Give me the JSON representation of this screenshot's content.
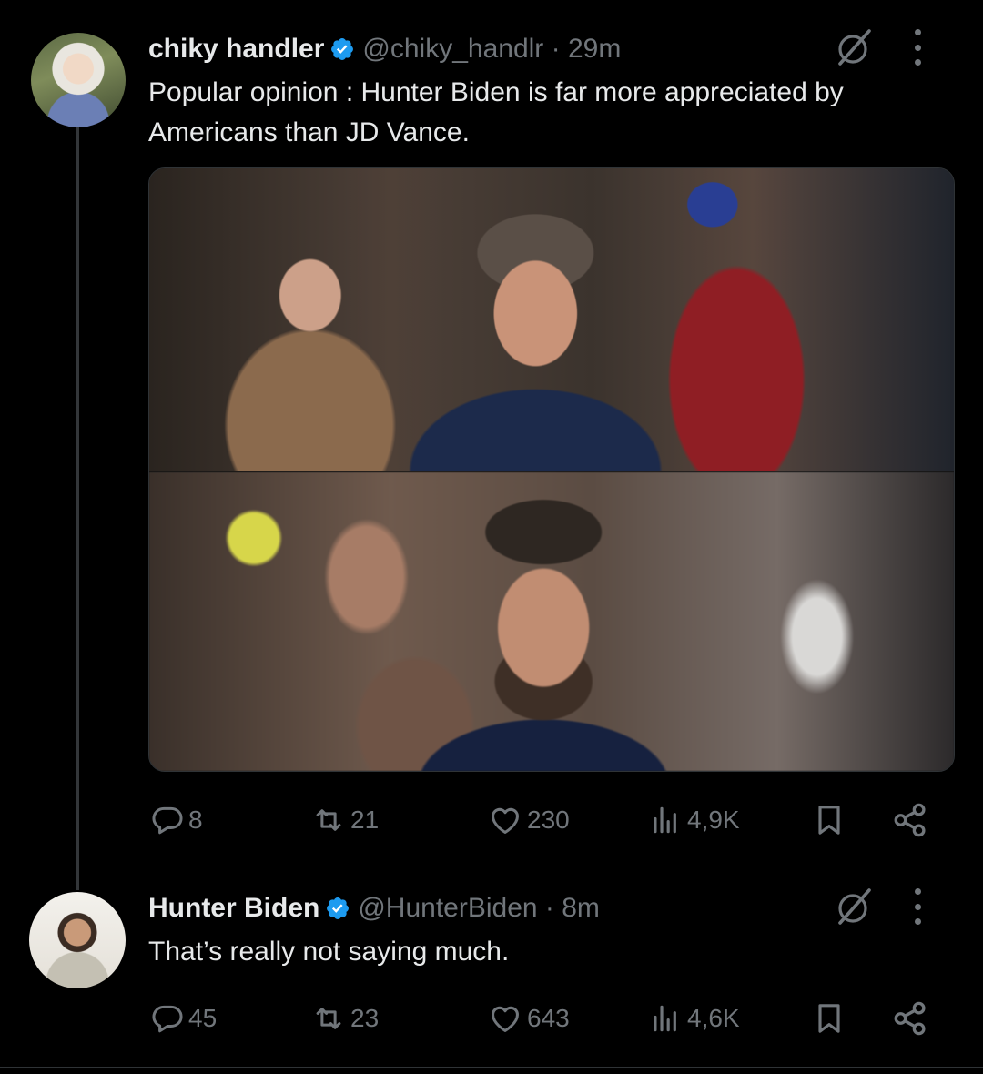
{
  "colors": {
    "background": "#000000",
    "text": "#e7e9ea",
    "muted": "#71767b",
    "verified": "#1d9bf0"
  },
  "tweets": [
    {
      "author": {
        "name": "chiky handler",
        "handle": "@chiky_handlr",
        "time": "29m",
        "verified": true
      },
      "text": "Popular opinion : Hunter Biden is far more appreciated by Americans than JD Vance.",
      "media": [
        "photo-hunter-biden",
        "photo-jd-vance"
      ],
      "actions": {
        "replies": "8",
        "reposts": "21",
        "likes": "230",
        "views": "4,9K"
      }
    },
    {
      "author": {
        "name": "Hunter Biden",
        "handle": "@HunterBiden",
        "time": "8m",
        "verified": true
      },
      "text": "That’s really not saying much.",
      "actions": {
        "replies": "45",
        "reposts": "23",
        "likes": "643",
        "views": "4,6K"
      }
    }
  ],
  "icons": [
    "grok-icon",
    "more-icon",
    "reply-icon",
    "repost-icon",
    "like-icon",
    "views-icon",
    "bookmark-icon",
    "share-icon",
    "verified-badge-icon"
  ]
}
